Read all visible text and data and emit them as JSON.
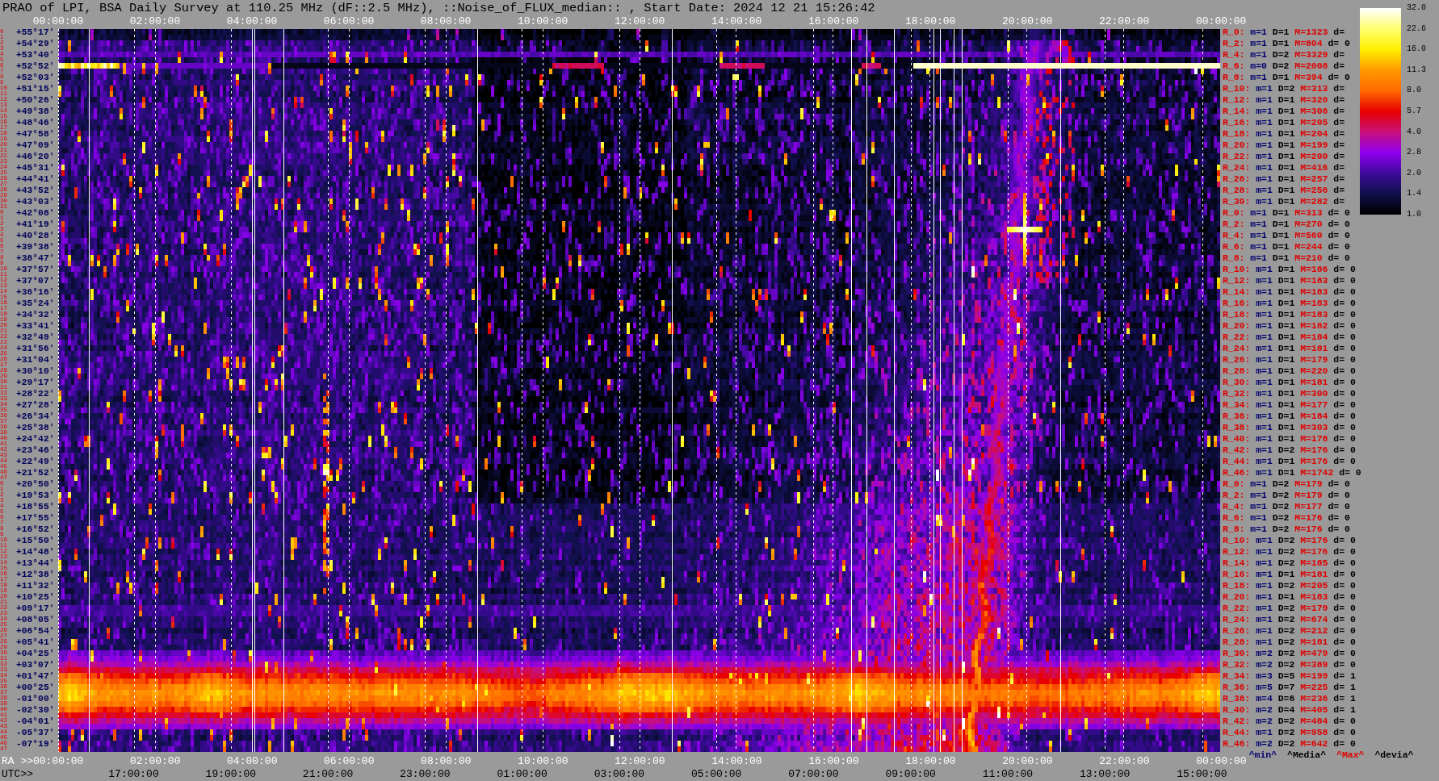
{
  "title": "PRAO of LPI, BSA Daily Survey at 110.25 MHz (dF::2.5 MHz), ::Noise_of_FLUX_median:: , Start Date: 2024 12 21 15:26:42",
  "top_axis": {
    "ticks": [
      "00:00:00",
      "02:00:00",
      "04:00:00",
      "06:00:00",
      "08:00:00",
      "10:00:00",
      "12:00:00",
      "14:00:00",
      "16:00:00",
      "18:00:00",
      "20:00:00",
      "22:00:00",
      "00:00:00"
    ]
  },
  "colorbar": {
    "labels": [
      "32.0",
      "22.6",
      "16.0",
      "11.3",
      "8.0",
      "5.7",
      "4.0",
      "2.8",
      "2.0",
      "1.4",
      "1.0"
    ]
  },
  "blocks": [
    {
      "beam_numbers": [
        "0",
        "1",
        "2",
        "3",
        "4",
        "5",
        "6",
        "7",
        "8",
        "9",
        "10",
        "11",
        "12",
        "13",
        "14",
        "15",
        "16",
        "17",
        "18",
        "19",
        "20",
        "21",
        "22",
        "23",
        "24",
        "25",
        "26",
        "27",
        "28",
        "29",
        "30",
        "31"
      ],
      "declinations": [
        "+55°17′",
        "+54°29′",
        "+53°40′",
        "+52°52′",
        "+52°03′",
        "+51°15′",
        "+50°26′",
        "+49°38′",
        "+48°46′",
        "+47°58′",
        "+47°09′",
        "+46°20′",
        "+45°31′",
        "+44°41′",
        "+43°52′",
        "+43°03′"
      ],
      "stats": [
        {
          "beam": "R_0:",
          "min": "m=1",
          "median": "D=1",
          "max": "M=1323",
          "dev": "d="
        },
        {
          "beam": "R_2:",
          "min": "m=1",
          "median": "D=1",
          "max": "M=804",
          "dev": "d= 0"
        },
        {
          "beam": "R_4:",
          "min": "m=1",
          "median": "D=2",
          "max": "M=3329",
          "dev": "d="
        },
        {
          "beam": "R_6:",
          "min": "m=0",
          "median": "D=2",
          "max": "M=2008",
          "dev": "d="
        },
        {
          "beam": "R_8:",
          "min": "m=1",
          "median": "D=1",
          "max": "M=394",
          "dev": "d= 0"
        },
        {
          "beam": "R_10:",
          "min": "m=1",
          "median": "D=2",
          "max": "M=313",
          "dev": "d="
        },
        {
          "beam": "R_12:",
          "min": "m=1",
          "median": "D=1",
          "max": "M=320",
          "dev": "d="
        },
        {
          "beam": "R_14:",
          "min": "m=1",
          "median": "D=1",
          "max": "M=306",
          "dev": "d="
        },
        {
          "beam": "R_16:",
          "min": "m=1",
          "median": "D=1",
          "max": "M=205",
          "dev": "d="
        },
        {
          "beam": "R_18:",
          "min": "m=1",
          "median": "D=1",
          "max": "M=204",
          "dev": "d="
        },
        {
          "beam": "R_20:",
          "min": "m=1",
          "median": "D=1",
          "max": "M=199",
          "dev": "d="
        },
        {
          "beam": "R_22:",
          "min": "m=1",
          "median": "D=1",
          "max": "M=200",
          "dev": "d="
        },
        {
          "beam": "R_24:",
          "min": "m=1",
          "median": "D=1",
          "max": "M=416",
          "dev": "d="
        },
        {
          "beam": "R_26:",
          "min": "m=1",
          "median": "D=1",
          "max": "M=257",
          "dev": "d="
        },
        {
          "beam": "R_28:",
          "min": "m=1",
          "median": "D=1",
          "max": "M=256",
          "dev": "d="
        },
        {
          "beam": "R_30:",
          "min": "m=1",
          "median": "D=1",
          "max": "M=282",
          "dev": "d="
        }
      ]
    },
    {
      "beam_numbers": [
        "0",
        "1",
        "2",
        "3",
        "4",
        "5",
        "6",
        "7",
        "8",
        "9",
        "10",
        "11",
        "12",
        "13",
        "14",
        "15",
        "16",
        "17",
        "18",
        "19",
        "20",
        "21",
        "22",
        "23",
        "24",
        "25",
        "26",
        "27",
        "28",
        "29",
        "30",
        "31",
        "32",
        "33",
        "34",
        "35",
        "36",
        "37",
        "38",
        "39",
        "40",
        "41",
        "42",
        "43",
        "44",
        "45",
        "46",
        "47"
      ],
      "declinations": [
        "+42°08′",
        "+41°19′",
        "+40°28′",
        "+39°38′",
        "+38°47′",
        "+37°57′",
        "+37°07′",
        "+36°16′",
        "+35°24′",
        "+34°32′",
        "+33°41′",
        "+32°49′",
        "+31°56′",
        "+31°04′",
        "+30°10′",
        "+29°17′",
        "+28°22′",
        "+27°28′",
        "+26°34′",
        "+25°38′",
        "+24°42′",
        "+23°46′",
        "+22°49′",
        "+21°52′"
      ],
      "stats": [
        {
          "beam": "R_0:",
          "min": "m=1",
          "median": "D=1",
          "max": "M=313",
          "dev": "d= 0"
        },
        {
          "beam": "R_2:",
          "min": "m=1",
          "median": "D=1",
          "max": "M=270",
          "dev": "d= 0"
        },
        {
          "beam": "R_4:",
          "min": "m=1",
          "median": "D=1",
          "max": "M=560",
          "dev": "d= 0"
        },
        {
          "beam": "R_6:",
          "min": "m=1",
          "median": "D=1",
          "max": "M=244",
          "dev": "d= 0"
        },
        {
          "beam": "R_8:",
          "min": "m=1",
          "median": "D=1",
          "max": "M=210",
          "dev": "d= 0"
        },
        {
          "beam": "R_10:",
          "min": "m=1",
          "median": "D=1",
          "max": "M=186",
          "dev": "d= 0"
        },
        {
          "beam": "R_12:",
          "min": "m=1",
          "median": "D=1",
          "max": "M=183",
          "dev": "d= 0"
        },
        {
          "beam": "R_14:",
          "min": "m=1",
          "median": "D=1",
          "max": "M=183",
          "dev": "d= 0"
        },
        {
          "beam": "R_16:",
          "min": "m=1",
          "median": "D=1",
          "max": "M=183",
          "dev": "d= 0"
        },
        {
          "beam": "R_18:",
          "min": "m=1",
          "median": "D=1",
          "max": "M=183",
          "dev": "d= 0"
        },
        {
          "beam": "R_20:",
          "min": "m=1",
          "median": "D=1",
          "max": "M=182",
          "dev": "d= 0"
        },
        {
          "beam": "R_22:",
          "min": "m=1",
          "median": "D=1",
          "max": "M=184",
          "dev": "d= 0"
        },
        {
          "beam": "R_24:",
          "min": "m=1",
          "median": "D=1",
          "max": "M=181",
          "dev": "d= 0"
        },
        {
          "beam": "R_26:",
          "min": "m=1",
          "median": "D=1",
          "max": "M=179",
          "dev": "d= 0"
        },
        {
          "beam": "R_28:",
          "min": "m=1",
          "median": "D=1",
          "max": "M=220",
          "dev": "d= 0"
        },
        {
          "beam": "R_30:",
          "min": "m=1",
          "median": "D=1",
          "max": "M=181",
          "dev": "d= 0"
        },
        {
          "beam": "R_32:",
          "min": "m=1",
          "median": "D=1",
          "max": "M=300",
          "dev": "d= 0"
        },
        {
          "beam": "R_34:",
          "min": "m=1",
          "median": "D=1",
          "max": "M=177",
          "dev": "d= 0"
        },
        {
          "beam": "R_36:",
          "min": "m=1",
          "median": "D=1",
          "max": "M=184",
          "dev": "d= 0"
        },
        {
          "beam": "R_38:",
          "min": "m=1",
          "median": "D=1",
          "max": "M=303",
          "dev": "d= 0"
        },
        {
          "beam": "R_40:",
          "min": "m=1",
          "median": "D=1",
          "max": "M=178",
          "dev": "d= 0"
        },
        {
          "beam": "R_42:",
          "min": "m=1",
          "median": "D=2",
          "max": "M=176",
          "dev": "d= 0"
        },
        {
          "beam": "R_44:",
          "min": "m=1",
          "median": "D=1",
          "max": "M=176",
          "dev": "d= 0"
        },
        {
          "beam": "R_46:",
          "min": "m=1",
          "median": "D=1",
          "max": "M=1742",
          "dev": "d= 0"
        }
      ]
    },
    {
      "beam_numbers": [
        "0",
        "1",
        "2",
        "3",
        "4",
        "5",
        "6",
        "7",
        "8",
        "9",
        "10",
        "11",
        "12",
        "13",
        "14",
        "15",
        "16",
        "17",
        "18",
        "19",
        "20",
        "21",
        "22",
        "23",
        "24",
        "25",
        "26",
        "27",
        "28",
        "29",
        "30",
        "31",
        "32",
        "33",
        "34",
        "35",
        "36",
        "37",
        "38",
        "39",
        "40",
        "41",
        "42",
        "43",
        "44",
        "45",
        "46",
        "47"
      ],
      "declinations": [
        "+20°50′",
        "+19°53′",
        "+18°55′",
        "+17°55′",
        "+16°52′",
        "+15°50′",
        "+14°48′",
        "+13°44′",
        "+12°38′",
        "+11°32′",
        "+10°25′",
        "+09°17′",
        "+08°05′",
        "+06°54′",
        "+05°41′",
        "+04°25′",
        "+03°07′",
        "+01°47′",
        "+00°25′",
        "-01°00′",
        "-02°30′",
        "-04°01′",
        "-05°37′",
        "-07°19′"
      ],
      "stats": [
        {
          "beam": "R_0:",
          "min": "m=1",
          "median": "D=2",
          "max": "M=179",
          "dev": "d= 0"
        },
        {
          "beam": "R_2:",
          "min": "m=1",
          "median": "D=2",
          "max": "M=179",
          "dev": "d= 0"
        },
        {
          "beam": "R_4:",
          "min": "m=1",
          "median": "D=2",
          "max": "M=177",
          "dev": "d= 0"
        },
        {
          "beam": "R_6:",
          "min": "m=1",
          "median": "D=2",
          "max": "M=176",
          "dev": "d= 0"
        },
        {
          "beam": "R_8:",
          "min": "m=1",
          "median": "D=2",
          "max": "M=176",
          "dev": "d= 0"
        },
        {
          "beam": "R_10:",
          "min": "m=1",
          "median": "D=2",
          "max": "M=176",
          "dev": "d= 0"
        },
        {
          "beam": "R_12:",
          "min": "m=1",
          "median": "D=2",
          "max": "M=176",
          "dev": "d= 0"
        },
        {
          "beam": "R_14:",
          "min": "m=1",
          "median": "D=2",
          "max": "M=185",
          "dev": "d= 0"
        },
        {
          "beam": "R_16:",
          "min": "m=1",
          "median": "D=1",
          "max": "M=181",
          "dev": "d= 0"
        },
        {
          "beam": "R_18:",
          "min": "m=1",
          "median": "D=2",
          "max": "M=205",
          "dev": "d= 0"
        },
        {
          "beam": "R_20:",
          "min": "m=1",
          "median": "D=1",
          "max": "M=183",
          "dev": "d= 0"
        },
        {
          "beam": "R_22:",
          "min": "m=1",
          "median": "D=2",
          "max": "M=179",
          "dev": "d= 0"
        },
        {
          "beam": "R_24:",
          "min": "m=1",
          "median": "D=2",
          "max": "M=674",
          "dev": "d= 0"
        },
        {
          "beam": "R_26:",
          "min": "m=1",
          "median": "D=2",
          "max": "M=212",
          "dev": "d= 0"
        },
        {
          "beam": "R_28:",
          "min": "m=1",
          "median": "D=2",
          "max": "M=181",
          "dev": "d= 0"
        },
        {
          "beam": "R_30:",
          "min": "m=2",
          "median": "D=2",
          "max": "M=479",
          "dev": "d= 0"
        },
        {
          "beam": "R_32:",
          "min": "m=2",
          "median": "D=2",
          "max": "M=389",
          "dev": "d= 0"
        },
        {
          "beam": "R_34:",
          "min": "m=3",
          "median": "D=5",
          "max": "M=199",
          "dev": "d= 1"
        },
        {
          "beam": "R_36:",
          "min": "m=5",
          "median": "D=7",
          "max": "M=225",
          "dev": "d= 1"
        },
        {
          "beam": "R_38:",
          "min": "m=4",
          "median": "D=6",
          "max": "M=236",
          "dev": "d= 1"
        },
        {
          "beam": "R_40:",
          "min": "m=2",
          "median": "D=4",
          "max": "M=405",
          "dev": "d= 1"
        },
        {
          "beam": "R_42:",
          "min": "m=2",
          "median": "D=2",
          "max": "M=484",
          "dev": "d= 0"
        },
        {
          "beam": "R_44:",
          "min": "m=1",
          "median": "D=2",
          "max": "M=958",
          "dev": "d= 0"
        },
        {
          "beam": "R_46:",
          "min": "m=2",
          "median": "D=2",
          "max": "M=642",
          "dev": "d= 0"
        }
      ]
    }
  ],
  "legend": [
    {
      "kind": "min",
      "text": "^min^"
    },
    {
      "kind": "median",
      "text": "^Media^"
    },
    {
      "kind": "max",
      "text": "^Max^"
    },
    {
      "kind": "dev",
      "text": "^devia^"
    }
  ],
  "bottom_axis": {
    "ra": {
      "caption": "RA >>",
      "ticks": [
        "00:00:00",
        "02:00:00",
        "04:00:00",
        "06:00:00",
        "08:00:00",
        "10:00:00",
        "12:00:00",
        "14:00:00",
        "16:00:00",
        "18:00:00",
        "20:00:00",
        "22:00:00",
        "00:00:00"
      ]
    },
    "utc": {
      "caption": "UTC>>",
      "ticks": [
        "17:00:00",
        "19:00:00",
        "21:00:00",
        "23:00:00",
        "01:00:00",
        "03:00:00",
        "05:00:00",
        "07:00:00",
        "09:00:00",
        "11:00:00",
        "13:00:00",
        "15:00:00"
      ]
    }
  }
}
